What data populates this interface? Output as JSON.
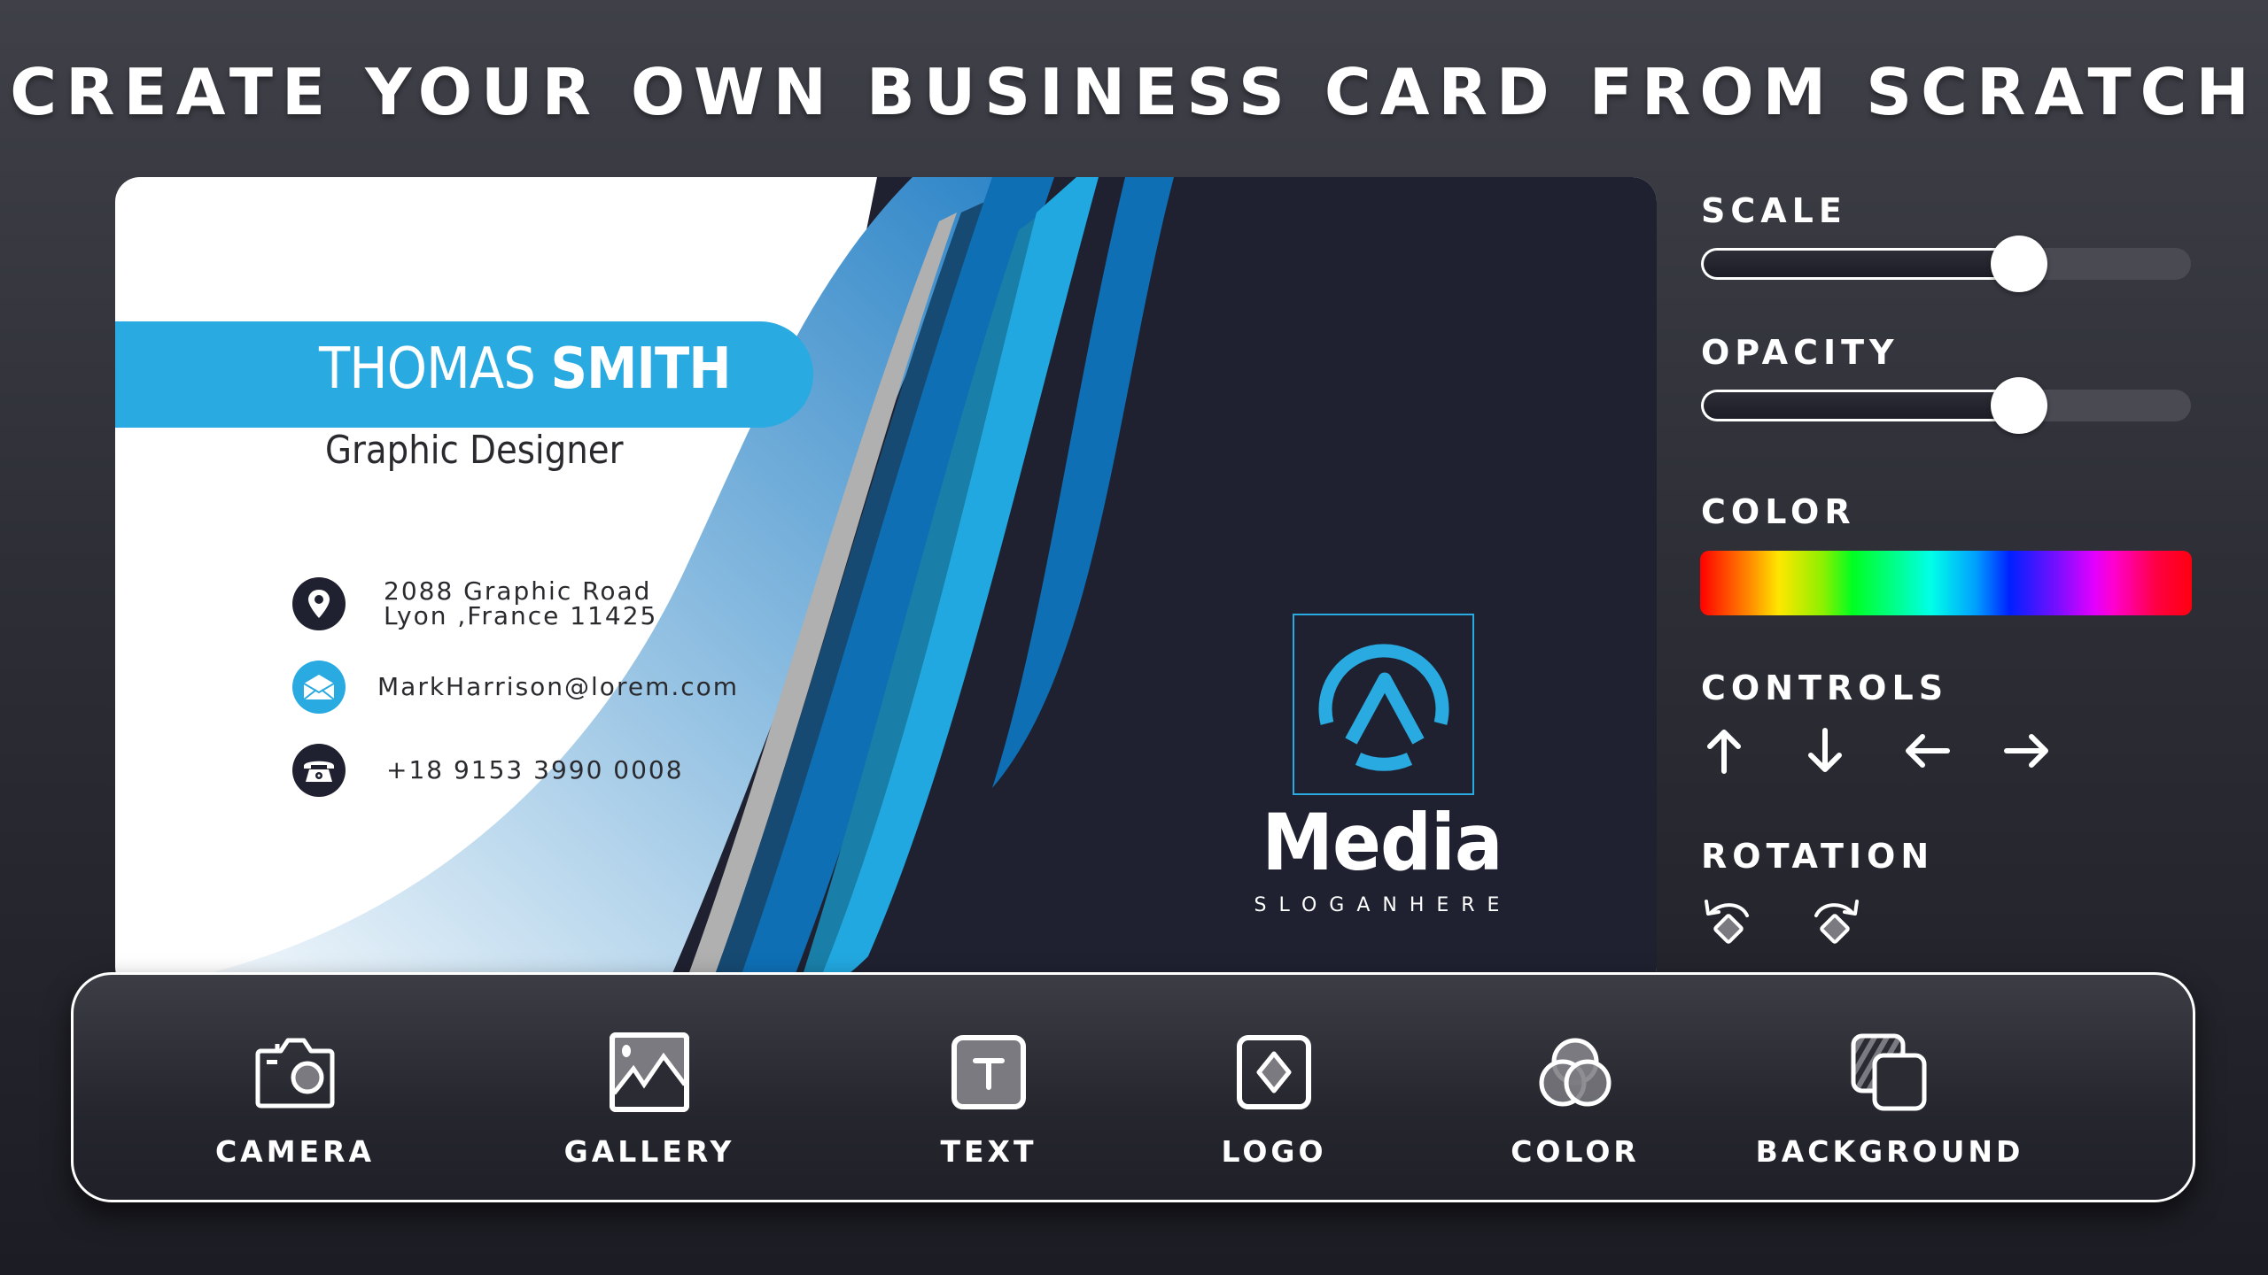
{
  "header": {
    "title": "CREATE YOUR OWN BUSINESS CARD FROM SCRATCH"
  },
  "card": {
    "name_first": "THOMAS ",
    "name_last": "SMITH",
    "job_title": "Graphic Designer",
    "address_line1": "2088 Graphic Road",
    "address_line2": "Lyon ,France 11425",
    "email": "MarkHarrison@lorem.com",
    "phone": "+18 9153 3990 0008",
    "logo_word": "Media",
    "slogan": "SLOGANHERE",
    "colors": {
      "band": "#29aae1",
      "dark": "#1f2130",
      "wave_blue": "#0e6fb5",
      "wave_light": "#22a8e0"
    }
  },
  "panel": {
    "scale": {
      "label": "SCALE",
      "value_fraction": 0.65
    },
    "opacity": {
      "label": "OPACITY",
      "value_fraction": 0.65
    },
    "color": {
      "label": "COLOR"
    },
    "controls": {
      "label": "CONTROLS",
      "buttons": [
        {
          "name": "up",
          "icon": "arrow-up-icon"
        },
        {
          "name": "down",
          "icon": "arrow-down-icon"
        },
        {
          "name": "left",
          "icon": "arrow-left-icon"
        },
        {
          "name": "right",
          "icon": "arrow-right-icon"
        }
      ]
    },
    "rotation": {
      "label": "ROTATION",
      "buttons": [
        {
          "name": "rotate-left",
          "icon": "rotate-left-icon"
        },
        {
          "name": "rotate-right",
          "icon": "rotate-right-icon"
        }
      ]
    }
  },
  "toolbar": {
    "items": [
      {
        "label": "CAMERA",
        "icon": "camera-icon"
      },
      {
        "label": "GALLERY",
        "icon": "gallery-icon"
      },
      {
        "label": "TEXT",
        "icon": "text-icon"
      },
      {
        "label": "LOGO",
        "icon": "logo-icon"
      },
      {
        "label": "COLOR",
        "icon": "color-icon"
      },
      {
        "label": "BACKGROUND",
        "icon": "background-icon"
      }
    ]
  }
}
